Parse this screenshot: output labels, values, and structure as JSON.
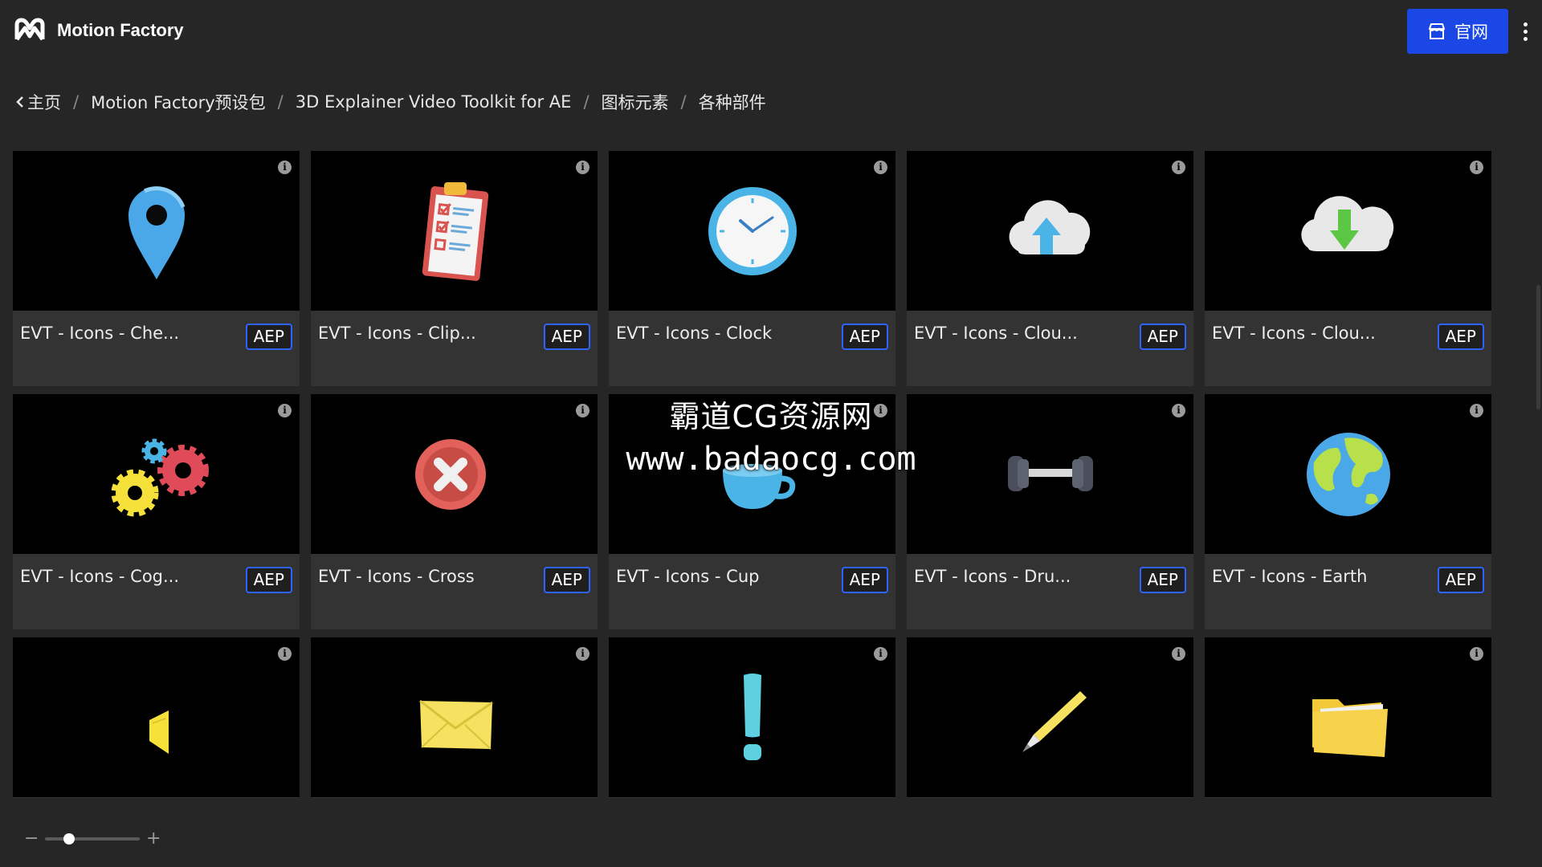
{
  "app": {
    "title": "Motion Factory",
    "site_button_label": "官网"
  },
  "breadcrumb": [
    {
      "label": "主页"
    },
    {
      "label": "Motion Factory预设包"
    },
    {
      "label": "3D Explainer Video Toolkit for AE"
    },
    {
      "label": "图标元素"
    },
    {
      "label": "各种部件"
    }
  ],
  "cards": [
    {
      "title": "EVT - Icons - Che...",
      "badge": "AEP",
      "icon": "map-pin-icon"
    },
    {
      "title": "EVT - Icons - Clip...",
      "badge": "AEP",
      "icon": "clipboard-icon"
    },
    {
      "title": "EVT - Icons - Clock",
      "badge": "AEP",
      "icon": "clock-icon"
    },
    {
      "title": "EVT - Icons - Clou...",
      "badge": "AEP",
      "icon": "cloud-upload-icon"
    },
    {
      "title": "EVT - Icons - Clou...",
      "badge": "AEP",
      "icon": "cloud-download-icon"
    },
    {
      "title": "EVT - Icons - Cog...",
      "badge": "AEP",
      "icon": "cogs-icon"
    },
    {
      "title": "EVT - Icons - Cross",
      "badge": "AEP",
      "icon": "cross-icon"
    },
    {
      "title": "EVT - Icons - Cup",
      "badge": "AEP",
      "icon": "cup-icon"
    },
    {
      "title": "EVT - Icons - Dru...",
      "badge": "AEP",
      "icon": "dumbbell-icon"
    },
    {
      "title": "EVT - Icons - Earth",
      "badge": "AEP",
      "icon": "earth-icon"
    },
    {
      "title": "",
      "badge": "",
      "icon": "card-icon"
    },
    {
      "title": "",
      "badge": "",
      "icon": "envelope-icon"
    },
    {
      "title": "",
      "badge": "",
      "icon": "exclamation-icon"
    },
    {
      "title": "",
      "badge": "",
      "icon": "pen-icon"
    },
    {
      "title": "",
      "badge": "",
      "icon": "folder-icon"
    }
  ],
  "watermark": {
    "line1": "霸道CG资源网",
    "line2": "www.badaocg.com"
  },
  "zoom": {
    "minus": "−",
    "plus": "+",
    "level": 0.22
  },
  "colors": {
    "accent": "#1a47e6",
    "badge_border": "#2f63ff",
    "background": "#262626",
    "card": "#333333"
  }
}
